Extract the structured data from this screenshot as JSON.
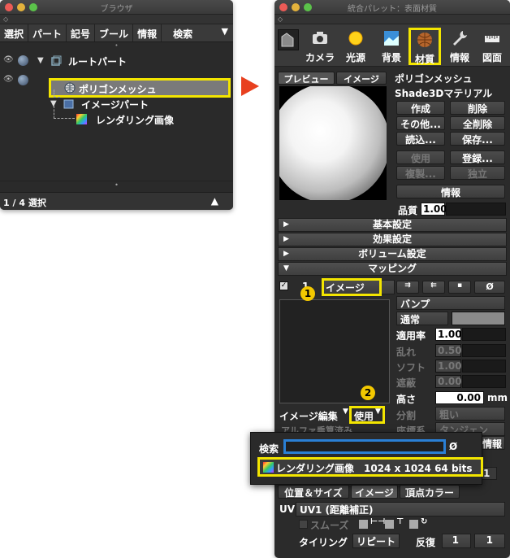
{
  "browser": {
    "title": "ブラウザ",
    "menu": [
      "選択",
      "パート",
      "記号",
      "ブール",
      "情報",
      "検索"
    ],
    "menu_more": "▼",
    "tree": {
      "root": "ルートパート",
      "polygon_mesh": "ポリゴンメッシュ",
      "image_part": "イメージパート",
      "render_image": "レンダリング画像"
    },
    "status": "1 / 4 選択",
    "status_arrow": "▲"
  },
  "palette": {
    "title": "統合パレット：表面材質",
    "tools": [
      "カメラ",
      "光源",
      "背景",
      "材質",
      "情報",
      "図面"
    ],
    "selected_tool": "材質",
    "tabs": [
      "プレビュー",
      "イメージ"
    ],
    "surface_name": "ポリゴンメッシュ",
    "material_name": "Shade3Dマテリアル",
    "buttons": {
      "create": "作成",
      "delete": "削除",
      "other": "その他...",
      "delete_all": "全削除",
      "load": "読込...",
      "save": "保存...",
      "use": "使用",
      "register": "登録...",
      "duplicate": "複製...",
      "independent": "独立",
      "info": "情報"
    },
    "quality_label": "品質",
    "quality_value": "1.00",
    "sections": {
      "basic": "基本設定",
      "effect": "効果設定",
      "volume": "ボリューム設定",
      "mapping": "マッピング"
    },
    "mapping": {
      "image_label": "イメージ",
      "layer_label": "1",
      "type": "バンプ",
      "blend": "通常",
      "rate_label": "適用率",
      "rate_value": "1.00",
      "random_label": "乱れ",
      "random_value": "0.50",
      "soft_label": "ソフト",
      "soft_value": "1.00",
      "shield_label": "遮蔽",
      "shield_value": "0.00",
      "height_label": "高さ",
      "height_value": "0.00",
      "height_unit": "mm",
      "divide_label": "分割",
      "divide_value": "粗い",
      "coord_label": "座標系",
      "coord_value": "タンジェン",
      "image_edit": "イメージ編集",
      "use_label": "使用",
      "alpha_label": "アルファ乗算済み"
    },
    "bottom_tabs": [
      "位置＆サイズ",
      "イメージ",
      "頂点カラー"
    ],
    "uv_label": "UV",
    "uv_value": "UV1 (距離補正)",
    "smooth_label": "スムーズ",
    "tiling_label": "タイリング",
    "tiling_value": "リピート",
    "repeat_label": "反復",
    "repeat_x": "1",
    "repeat_y": "1",
    "info_side": "情報",
    "side_value": "1"
  },
  "popup": {
    "search_label": "検索",
    "search_value": "",
    "clear": "Ø",
    "item": "レンダリング画像　1024 x 1024 64 bits"
  },
  "badges": [
    "1",
    "2"
  ],
  "colors": {
    "highlight": "#f3e500",
    "arrow": "#e8401f",
    "badge": "#f3c800",
    "search_border": "#2a7fd4"
  }
}
